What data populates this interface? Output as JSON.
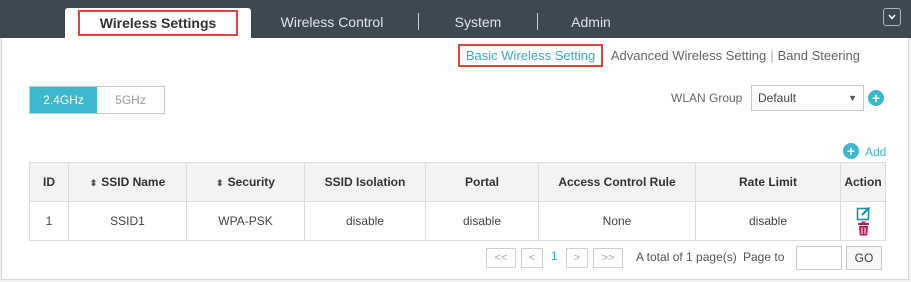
{
  "topnav": {
    "tabs": [
      {
        "label": "Wireless Settings",
        "active": true
      },
      {
        "label": "Wireless Control"
      },
      {
        "label": "System"
      },
      {
        "label": "Admin"
      }
    ],
    "menu_icon": "chevron-down-icon"
  },
  "subnav": {
    "items": [
      "Basic Wireless Setting",
      "Advanced Wireless Setting",
      "Band Steering"
    ],
    "active": "Basic Wireless Setting"
  },
  "band": {
    "options": [
      "2.4GHz",
      "5GHz"
    ],
    "selected": "2.4GHz"
  },
  "wlan": {
    "label": "WLAN Group",
    "value": "Default"
  },
  "add_label": "Add",
  "table": {
    "headers": [
      "ID",
      "SSID Name",
      "Security",
      "SSID Isolation",
      "Portal",
      "Access Control Rule",
      "Rate Limit",
      "Action"
    ],
    "rows": [
      {
        "id": "1",
        "ssid": "SSID1",
        "security": "WPA-PSK",
        "isolation": "disable",
        "portal": "disable",
        "acl": "None",
        "rate": "disable"
      }
    ]
  },
  "pagination": {
    "first": "<<",
    "prev": "<",
    "current": "1",
    "next": ">",
    "last": ">>",
    "total_text": "A total of 1 page(s)",
    "page_to_label": "Page to",
    "go_label": "GO"
  },
  "colors": {
    "accent": "#3cb8cd",
    "highlight": "#d9463c",
    "topbar": "#3d4852",
    "delete": "#c2185b"
  }
}
